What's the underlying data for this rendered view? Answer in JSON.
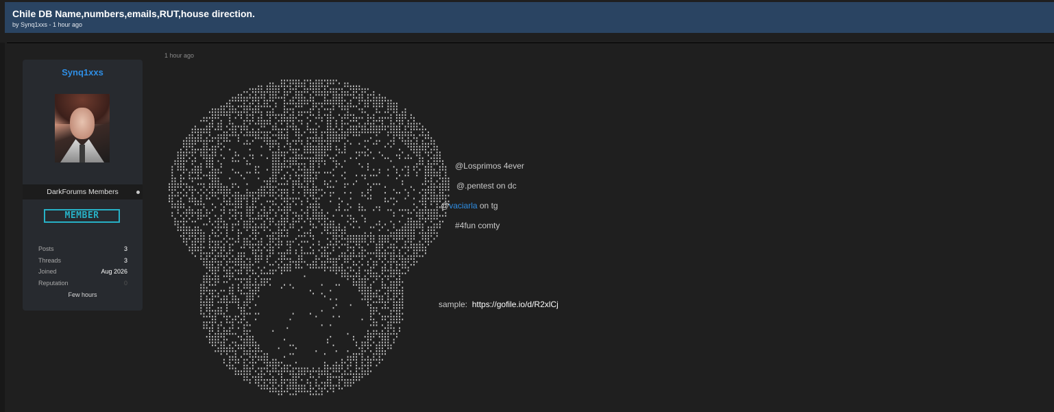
{
  "thread": {
    "title": "Chile DB Name,numbers,emails,RUT,house direction.",
    "byline": "by Synq1xxs - 1 hour ago"
  },
  "post": {
    "time": "1 hour ago",
    "lines": {
      "line1": "@Losprimos 4ever",
      "line2": "@.pentest on dc",
      "line3_prefix": "@",
      "line3_link": "vaciarla",
      "line3_suffix": " on tg",
      "line4": "#4fun comty",
      "sample_label": "sample:",
      "sample_url": "https://gofile.io/d/R2xlCj"
    }
  },
  "user": {
    "name": "Synq1xxs",
    "group": "DarkForums Members",
    "badge": "MEMBER",
    "stats": {
      "posts_label": "Posts",
      "posts": "3",
      "threads_label": "Threads",
      "threads": "3",
      "joined_label": "Joined",
      "joined": "Aug 2026",
      "reputation_label": "Reputation",
      "reputation": "0"
    },
    "online": "Few hours"
  },
  "colors": {
    "header_bg": "#2a4462",
    "accent_blue": "#2f8fe6",
    "badge_cyan": "#27b2c7"
  }
}
